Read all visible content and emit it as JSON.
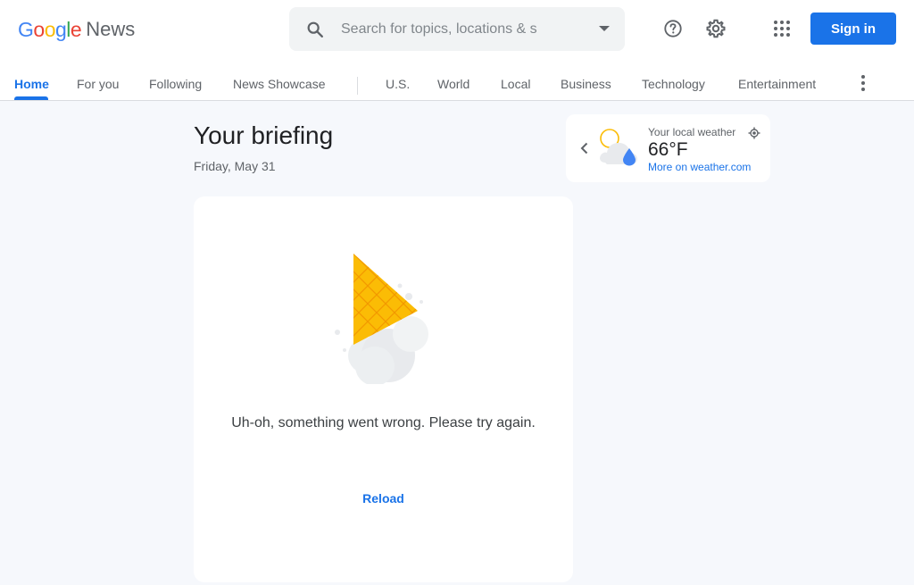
{
  "logo": {
    "google": [
      "G",
      "o",
      "o",
      "g",
      "l",
      "e"
    ],
    "product": "News"
  },
  "search": {
    "placeholder": "Search for topics, locations & s",
    "icon": "search-icon",
    "dropdown_icon": "arrow-drop-down-icon"
  },
  "header": {
    "help_icon": "help-icon",
    "settings_icon": "gear-icon",
    "apps_icon": "apps-grid-icon",
    "signin_label": "Sign in"
  },
  "nav": {
    "tabs": [
      {
        "label": "Home",
        "active": true
      },
      {
        "label": "For you"
      },
      {
        "label": "Following"
      },
      {
        "label": "News Showcase"
      },
      {
        "label": "U.S."
      },
      {
        "label": "World"
      },
      {
        "label": "Local"
      },
      {
        "label": "Business"
      },
      {
        "label": "Technology"
      },
      {
        "label": "Entertainment"
      }
    ],
    "more_icon": "more-vert-icon"
  },
  "briefing": {
    "title": "Your briefing",
    "date": "Friday, May 31"
  },
  "weather": {
    "label": "Your local weather",
    "temperature": "66°F",
    "link": "More on weather.com",
    "icon": "sun-cloud-rain-icon"
  },
  "error": {
    "message": "Uh-oh, something went wrong. Please try again.",
    "reload_label": "Reload"
  },
  "colors": {
    "accent": "#1a73e8",
    "background": "#f6f8fc",
    "card": "#ffffff"
  }
}
